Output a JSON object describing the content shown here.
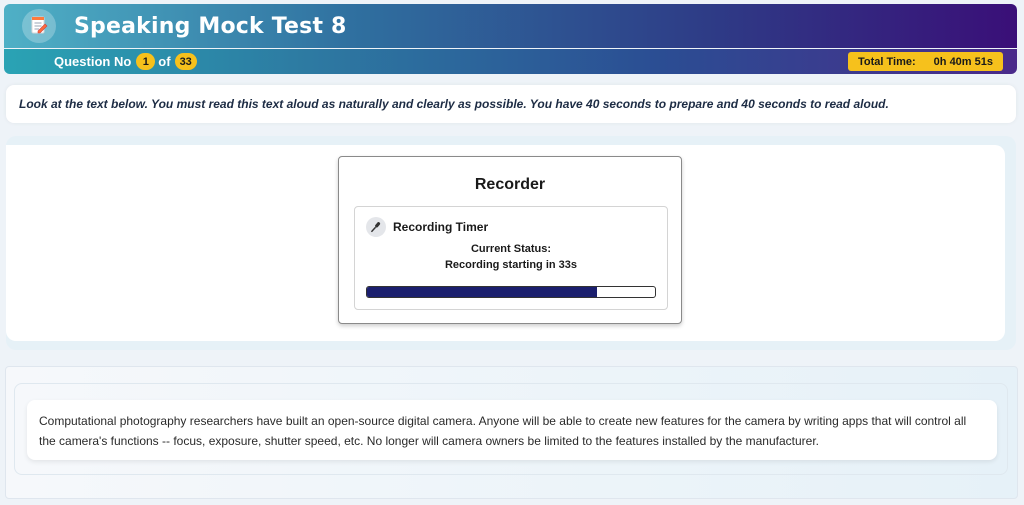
{
  "header": {
    "title": "Speaking Mock Test 8",
    "logo_icon": "notepad-pencil-icon"
  },
  "question_bar": {
    "label": "Question No",
    "current": "1",
    "of_label": "of",
    "total": "33",
    "time_label": "Total Time:",
    "time_value": "0h 40m 51s"
  },
  "instruction": "Look at the text below. You must read this text aloud as naturally and clearly as possible. You have 40 seconds to prepare and 40 seconds to read aloud.",
  "recorder": {
    "title": "Recorder",
    "timer_label": "Recording Timer",
    "status_label": "Current Status:",
    "status_value": "Recording starting in 33s",
    "progress_fraction": 0.8,
    "progress_color": "#1b1f6e"
  },
  "passage": "Computational photography researchers have built an open-source digital camera. Anyone will be able to create new features for the camera by writing apps that will control all the camera's functions -- focus, exposure, shutter speed, etc. No longer will camera owners be limited to the features installed by the manufacturer.",
  "colors": {
    "badge": "#f6c11c",
    "header_start": "#4fb0c6",
    "header_end": "#3a0f78"
  }
}
